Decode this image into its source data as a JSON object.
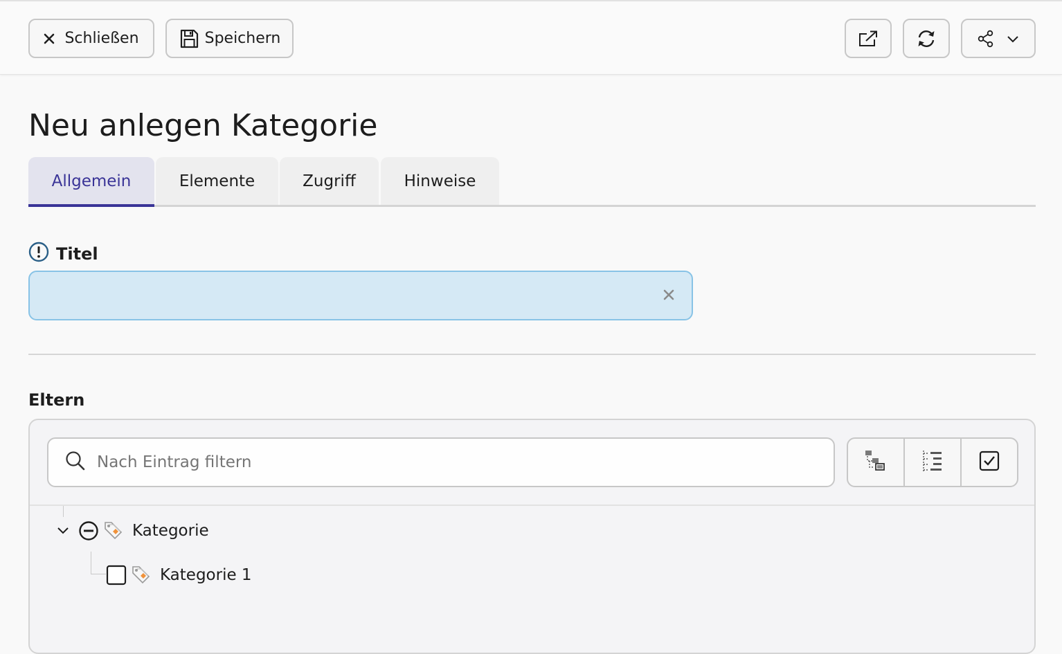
{
  "toolbar": {
    "close_label": "Schließen",
    "save_label": "Speichern"
  },
  "page": {
    "title": "Neu anlegen Kategorie"
  },
  "tabs": [
    {
      "label": "Allgemein",
      "active": true
    },
    {
      "label": "Elemente",
      "active": false
    },
    {
      "label": "Zugriff",
      "active": false
    },
    {
      "label": "Hinweise",
      "active": false
    }
  ],
  "form": {
    "title_label": "Titel",
    "title_value": ""
  },
  "parents": {
    "label": "Eltern",
    "filter_placeholder": "Nach Eintrag filtern",
    "tree": [
      {
        "label": "Kategorie",
        "expanded": true,
        "state": "indeterminate"
      },
      {
        "label": "Kategorie 1",
        "checked": false
      }
    ]
  },
  "colors": {
    "accent": "#3a3497",
    "input_background": "#d5e9f5",
    "input_border": "#88c3e6",
    "tag_icon": "#f0923b"
  }
}
